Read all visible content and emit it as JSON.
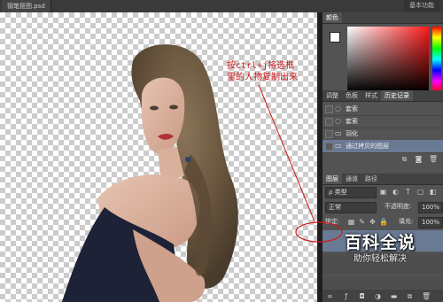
{
  "window": {
    "doc_tab": "钢笔抠图.psd",
    "workspace": "基本功能"
  },
  "annotation": {
    "line1": "按ctrl+j将选框",
    "line2": "里的人物复制出来"
  },
  "color_panel": {
    "tab": "颜色"
  },
  "adjust_panel": {
    "tabs": [
      "调整",
      "色板",
      "样式",
      "历史记录"
    ],
    "active_tab": "历史记录"
  },
  "history": {
    "items": [
      {
        "label": "套索",
        "icon": "lasso-icon"
      },
      {
        "label": "套索",
        "icon": "lasso-icon"
      },
      {
        "label": "羽化",
        "icon": "document-icon"
      },
      {
        "label": "通过拷贝的图层",
        "icon": "document-icon"
      }
    ]
  },
  "layers_panel": {
    "tabs": [
      "图层",
      "通道",
      "路径"
    ],
    "filter_label": "ρ 类型",
    "blend_mode": "正常",
    "opacity_label": "不透明度:",
    "opacity_value": "100%",
    "lock_label": "锁定:",
    "fill_label": "填充:",
    "fill_value": "100%"
  },
  "watermark": {
    "title": "百科全说",
    "subtitle": "助你轻松解决"
  },
  "colors": {
    "accent_red": "#d01818",
    "history_selected": "#6a7a94"
  }
}
